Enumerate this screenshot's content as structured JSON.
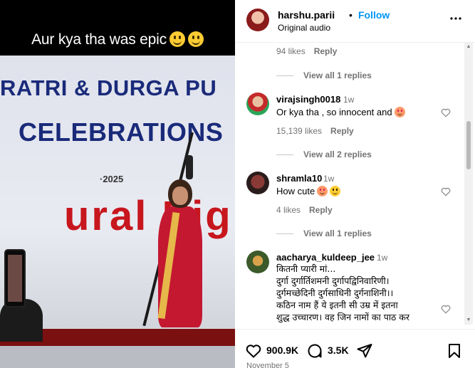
{
  "media": {
    "caption": "Aur kya tha was epic",
    "banner_line1": "RATRI & DURGA PU",
    "banner_line2": "CELEBRATIONS",
    "banner_year": "·2025",
    "banner_red": "ural Pig"
  },
  "post": {
    "username": "harshu.parii",
    "separator": "•",
    "follow_label": "Follow",
    "audio": "Original audio",
    "more_icon": "more-horizontal-icon"
  },
  "comments": {
    "top_meta": {
      "likes": "94 likes",
      "reply": "Reply"
    },
    "items": [
      {
        "pre_replies": "View all 1 replies",
        "username": "virajsingh0018",
        "time": "1w",
        "text": "Or kya tha , so innocent and",
        "likes": "15,139 likes",
        "reply": "Reply"
      },
      {
        "pre_replies": "View all 2 replies",
        "username": "shramla10",
        "time": "1w",
        "text": "How cute",
        "likes": "4 likes",
        "reply": "Reply"
      },
      {
        "pre_replies": "View all 1 replies",
        "username": "aacharya_kuldeep_jee",
        "time": "1w",
        "lines": [
          "कितनी प्यारी मां...",
          "दुर्गा दुर्गार्तिशमनी दुर्गापद्विनिवारिणी।",
          "दुर्गमच्छेदिनी दुर्गसाधिनी दुर्गनाशिनी।।",
          "कठिन नाम हैं ये इतनी सी उम्र में इतना",
          "शुद्ध उच्चारण। वह जिन नामों का पाठ कर"
        ]
      }
    ]
  },
  "actions": {
    "like_count": "900.9K",
    "comment_count": "3.5K",
    "icons": [
      "heart-icon",
      "comment-icon",
      "share-icon",
      "bookmark-icon"
    ]
  },
  "date": "November 5",
  "colors": {
    "follow": "#0095f6",
    "muted": "#737373"
  }
}
